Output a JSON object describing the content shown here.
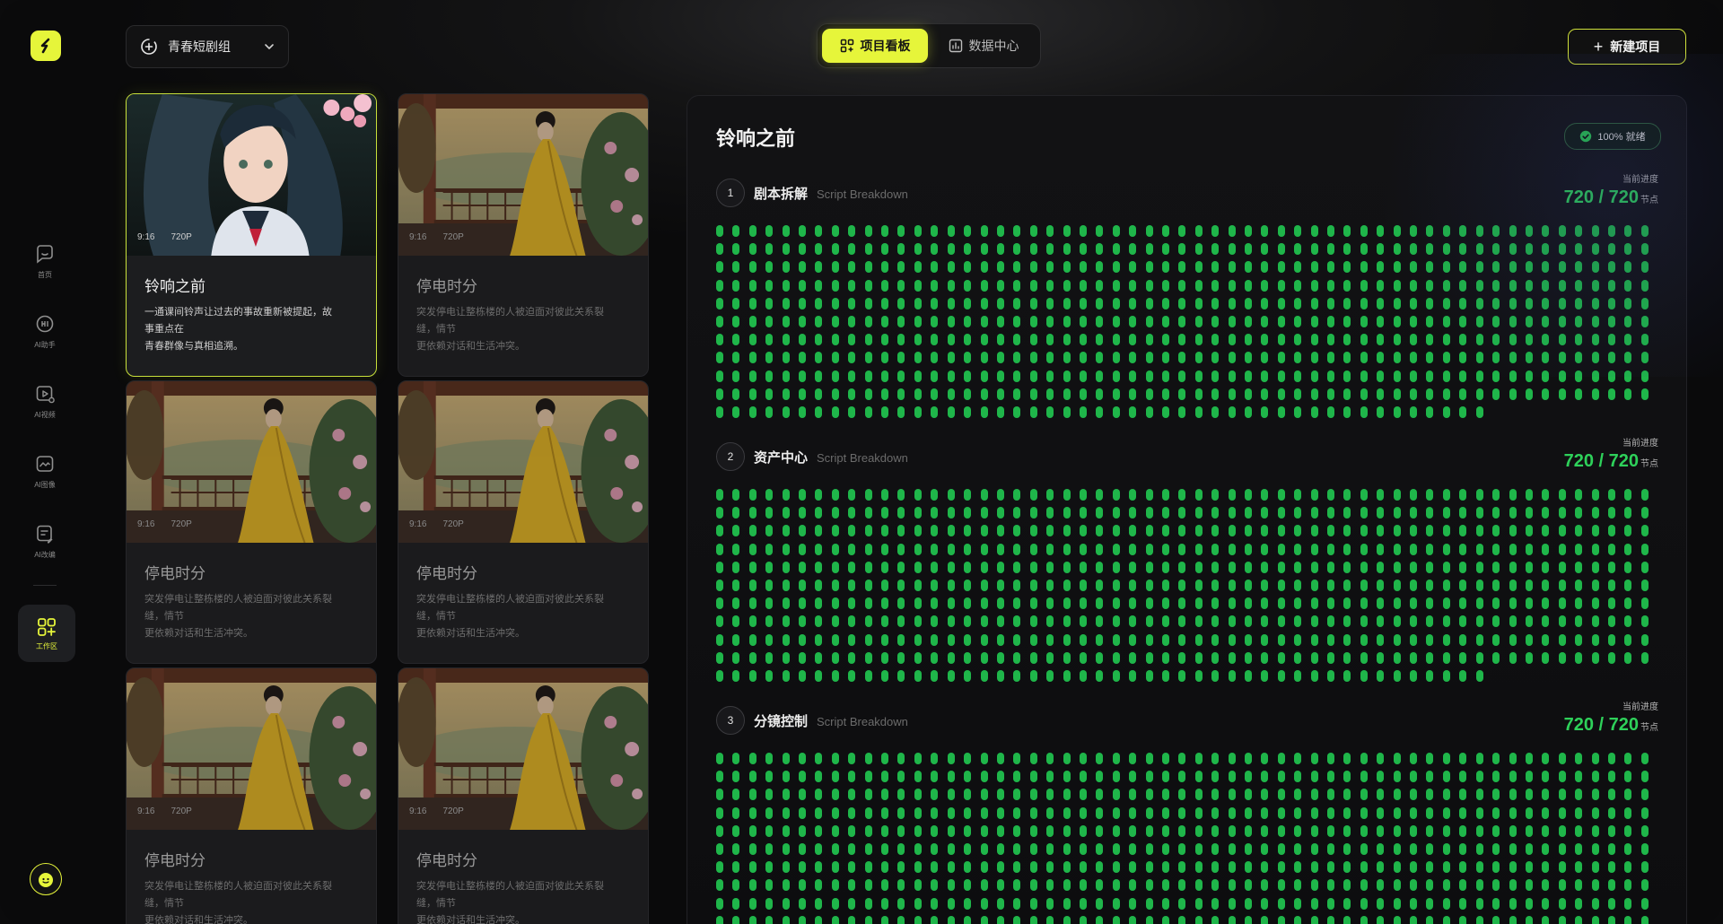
{
  "sidebar": {
    "nav": [
      {
        "label": "首页",
        "icon": "home-chat-icon"
      },
      {
        "label": "AI助手",
        "icon": "ai-assistant-icon"
      },
      {
        "label": "AI视频",
        "icon": "ai-video-icon"
      },
      {
        "label": "AI图像",
        "icon": "ai-image-icon"
      },
      {
        "label": "AI改编",
        "icon": "ai-edit-icon"
      }
    ],
    "active": {
      "label": "工作区",
      "icon": "workspace-grid-icon"
    }
  },
  "header": {
    "project_group": "青春短剧组",
    "tabs": [
      {
        "label": "项目看板",
        "active": true
      },
      {
        "label": "数据中心",
        "active": false
      }
    ],
    "new_button": "新建项目"
  },
  "cards": [
    {
      "title": "铃响之前",
      "ratio": "9:16",
      "resolution": "720P",
      "desc": [
        "一通课间铃声让过去的事故重新被提起，故",
        "事重点在",
        "青春群像与真相追溯。"
      ],
      "active": true
    },
    {
      "title": "停电时分",
      "ratio": "9:16",
      "resolution": "720P",
      "desc": [
        "突发停电让整栋楼的人被迫面对彼此关系裂",
        "缝，情节",
        "更依赖对话和生活冲突。"
      ],
      "active": false
    },
    {
      "title": "停电时分",
      "ratio": "9:16",
      "resolution": "720P",
      "desc": [
        "突发停电让整栋楼的人被迫面对彼此关系裂",
        "缝，情节",
        "更依赖对话和生活冲突。"
      ],
      "active": false
    },
    {
      "title": "停电时分",
      "ratio": "9:16",
      "resolution": "720P",
      "desc": [
        "突发停电让整栋楼的人被迫面对彼此关系裂",
        "缝，情节",
        "更依赖对话和生活冲突。"
      ],
      "active": false
    },
    {
      "title": "停电时分",
      "ratio": "9:16",
      "resolution": "720P",
      "desc": [
        "突发停电让整栋楼的人被迫面对彼此关系裂",
        "缝，情节",
        "更依赖对话和生活冲突。"
      ],
      "active": false
    },
    {
      "title": "停电时分",
      "ratio": "9:16",
      "resolution": "720P",
      "desc": [
        "突发停电让整栋楼的人被迫面对彼此关系裂",
        "缝，情节",
        "更依赖对话和生活冲突。"
      ],
      "active": false
    }
  ],
  "panel": {
    "title": "铃响之前",
    "status": "100% 就绪",
    "progress_label": "当前进度",
    "unit": "节点",
    "sections": [
      {
        "num": "1",
        "name": "剧本拆解",
        "sub": "Script Breakdown",
        "done": 720,
        "total": 720,
        "value": "720 / 720"
      },
      {
        "num": "2",
        "name": "资产中心",
        "sub": "Script Breakdown",
        "done": 720,
        "total": 720,
        "value": "720 / 720"
      },
      {
        "num": "3",
        "name": "分镜控制",
        "sub": "Script Breakdown",
        "done": 720,
        "total": 720,
        "value": "720 / 720"
      }
    ]
  },
  "colors": {
    "accent": "#e6f53a",
    "progress": "#1fb64a"
  }
}
